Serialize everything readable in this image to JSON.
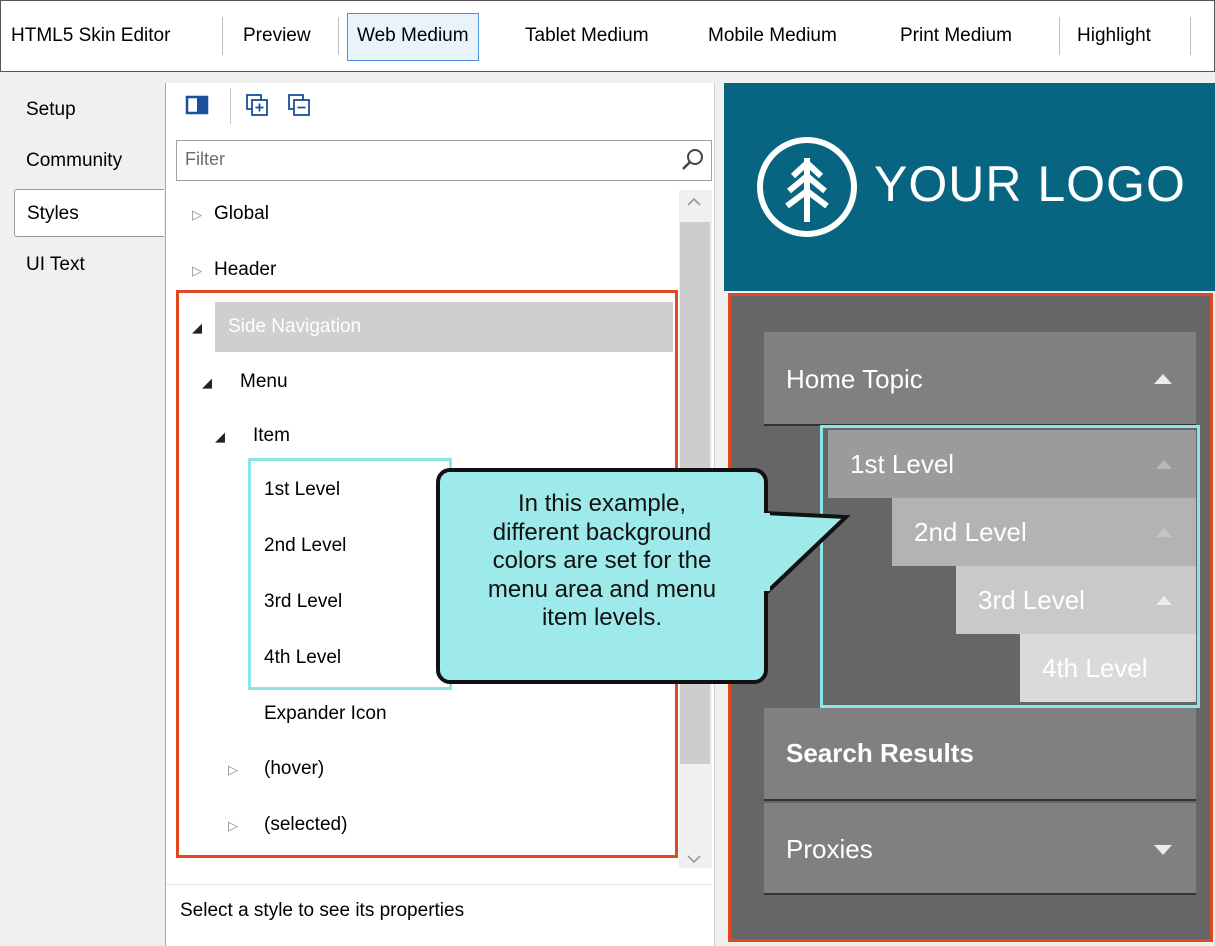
{
  "toolbar": {
    "items": [
      "HTML5 Skin Editor",
      "Preview",
      "Web Medium",
      "Tablet Medium",
      "Mobile Medium",
      "Print Medium",
      "Highlight"
    ],
    "active": "Web Medium"
  },
  "tabs": [
    "Setup",
    "Community",
    "Styles",
    "UI Text"
  ],
  "selected_tab": "Styles",
  "panel": {
    "tool_icons": [
      "toggle-panel-icon",
      "expand-all-icon",
      "collapse-all-icon"
    ],
    "filter_placeholder": "Filter",
    "tree": {
      "global": "Global",
      "header": "Header",
      "side_navigation": "Side Navigation",
      "menu": "Menu",
      "item": "Item",
      "level1": "1st Level",
      "level2": "2nd Level",
      "level3": "3rd Level",
      "level4": "4th Level",
      "expander_icon": "Expander Icon",
      "hover": "(hover)",
      "selected": "(selected)"
    },
    "status": "Select a style to see its properties"
  },
  "preview": {
    "logo_text": "YOUR LOGO",
    "home_topic": "Home Topic",
    "level1": "1st Level",
    "level2": "2nd Level",
    "level3": "3rd Level",
    "level4": "4th Level",
    "search_results": "Search Results",
    "proxies": "Proxies"
  },
  "callout": {
    "lines": [
      "In this example,",
      "different background",
      "colors are set for the",
      "menu area and menu",
      "item levels."
    ]
  },
  "colors": {
    "header_bg": "#086582",
    "menu_bg": "#666666",
    "callout_bg": "#9eeaea",
    "highlight_red": "#e0491f",
    "highlight_cyan": "#8de6e6"
  }
}
